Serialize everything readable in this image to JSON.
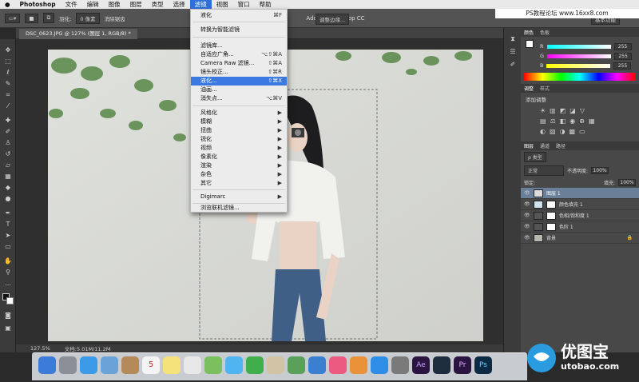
{
  "menubar": {
    "apple": "",
    "app": "Photoshop",
    "items": [
      "文件",
      "编辑",
      "图像",
      "图层",
      "类型",
      "选择",
      "滤镜",
      "视图",
      "窗口",
      "帮助"
    ],
    "active_index": 6
  },
  "window_title": "Adobe Photoshop CC",
  "watermark_site": "PS教程论坛 www.16xx8.com",
  "options": {
    "feather_label": "羽化:",
    "feather_value": "0 像素",
    "antialias": "消除锯齿",
    "style_label": "样式:",
    "refine_edge": "调整边缘...",
    "workspace": "基本功能"
  },
  "document_tab": "DSC_0623.JPG @ 127% (图层 1, RGB/8) *",
  "status": {
    "zoom": "127.5%",
    "doc": "文档:5.01M/11.2M"
  },
  "filter_menu": {
    "items": [
      {
        "label": "液化",
        "shortcut": "⌘F",
        "state": "normal"
      },
      {
        "label": "转换为智能滤镜",
        "shortcut": "",
        "state": "normal"
      },
      {
        "label": "滤镜库...",
        "shortcut": "",
        "state": "normal"
      },
      {
        "label": "自适应广角...",
        "shortcut": "⌥⇧⌘A",
        "state": "normal"
      },
      {
        "label": "Camera Raw 滤镜...",
        "shortcut": "⇧⌘A",
        "state": "normal"
      },
      {
        "label": "镜头校正...",
        "shortcut": "⇧⌘R",
        "state": "normal"
      },
      {
        "label": "液化...",
        "shortcut": "⇧⌘X",
        "state": "highlighted"
      },
      {
        "label": "油画...",
        "shortcut": "",
        "state": "normal"
      },
      {
        "label": "消失点...",
        "shortcut": "⌥⌘V",
        "state": "normal"
      },
      {
        "label": "风格化",
        "shortcut": "▶",
        "state": "normal"
      },
      {
        "label": "模糊",
        "shortcut": "▶",
        "state": "normal"
      },
      {
        "label": "扭曲",
        "shortcut": "▶",
        "state": "normal"
      },
      {
        "label": "锐化",
        "shortcut": "▶",
        "state": "normal"
      },
      {
        "label": "视频",
        "shortcut": "▶",
        "state": "normal"
      },
      {
        "label": "像素化",
        "shortcut": "▶",
        "state": "normal"
      },
      {
        "label": "渲染",
        "shortcut": "▶",
        "state": "normal"
      },
      {
        "label": "杂色",
        "shortcut": "▶",
        "state": "normal"
      },
      {
        "label": "其它",
        "shortcut": "▶",
        "state": "normal"
      },
      {
        "label": "Digimarc",
        "shortcut": "▶",
        "state": "normal"
      },
      {
        "label": "浏览联机滤镜...",
        "shortcut": "",
        "state": "normal"
      }
    ]
  },
  "color_panel": {
    "tabs": [
      "颜色",
      "色板"
    ],
    "r": "255",
    "g": "255",
    "b": "255",
    "r_label": "R",
    "g_label": "G",
    "b_label": "B"
  },
  "adjust_panel": {
    "tabs": [
      "调整",
      "样式"
    ],
    "title": "添加调整"
  },
  "layers_panel": {
    "tabs": [
      "图层",
      "通道",
      "路径"
    ],
    "kind": "ρ 类型",
    "blend": "正常",
    "opacity_label": "不透明度:",
    "opacity": "100%",
    "lock_label": "锁定:",
    "fill_label": "填充:",
    "fill": "100%",
    "layers": [
      {
        "name": "图层 1",
        "selected": true
      },
      {
        "name": "颜色填充 1",
        "selected": false
      },
      {
        "name": "色相/饱和度 1",
        "selected": false
      },
      {
        "name": "色阶 1",
        "selected": false
      },
      {
        "name": "背景",
        "selected": false
      }
    ]
  },
  "watermark": {
    "text_cn": "优图宝",
    "text_en": "utobao.com"
  },
  "colors": {
    "menu_highlight": "#3b78e0",
    "panel_bg": "#484848",
    "layer_selected": "#6a7f98"
  }
}
